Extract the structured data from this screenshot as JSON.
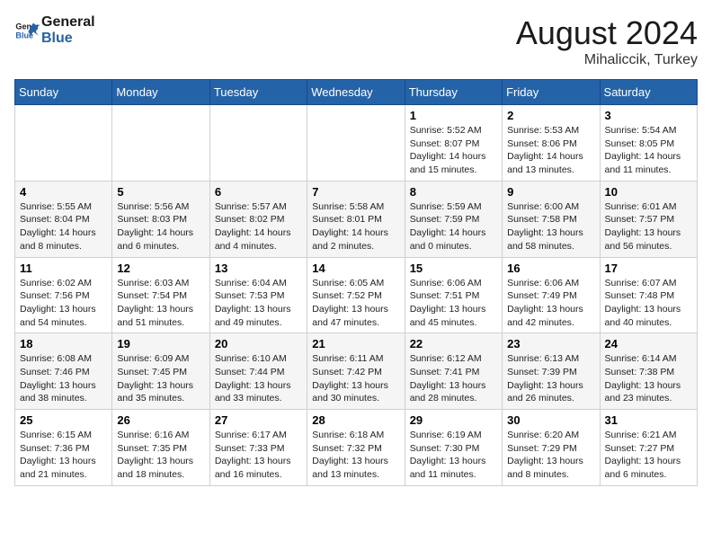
{
  "header": {
    "logo_general": "General",
    "logo_blue": "Blue",
    "month": "August 2024",
    "location": "Mihaliccik, Turkey"
  },
  "days_of_week": [
    "Sunday",
    "Monday",
    "Tuesday",
    "Wednesday",
    "Thursday",
    "Friday",
    "Saturday"
  ],
  "weeks": [
    [
      {
        "day": "",
        "info": ""
      },
      {
        "day": "",
        "info": ""
      },
      {
        "day": "",
        "info": ""
      },
      {
        "day": "",
        "info": ""
      },
      {
        "day": "1",
        "info": "Sunrise: 5:52 AM\nSunset: 8:07 PM\nDaylight: 14 hours\nand 15 minutes."
      },
      {
        "day": "2",
        "info": "Sunrise: 5:53 AM\nSunset: 8:06 PM\nDaylight: 14 hours\nand 13 minutes."
      },
      {
        "day": "3",
        "info": "Sunrise: 5:54 AM\nSunset: 8:05 PM\nDaylight: 14 hours\nand 11 minutes."
      }
    ],
    [
      {
        "day": "4",
        "info": "Sunrise: 5:55 AM\nSunset: 8:04 PM\nDaylight: 14 hours\nand 8 minutes."
      },
      {
        "day": "5",
        "info": "Sunrise: 5:56 AM\nSunset: 8:03 PM\nDaylight: 14 hours\nand 6 minutes."
      },
      {
        "day": "6",
        "info": "Sunrise: 5:57 AM\nSunset: 8:02 PM\nDaylight: 14 hours\nand 4 minutes."
      },
      {
        "day": "7",
        "info": "Sunrise: 5:58 AM\nSunset: 8:01 PM\nDaylight: 14 hours\nand 2 minutes."
      },
      {
        "day": "8",
        "info": "Sunrise: 5:59 AM\nSunset: 7:59 PM\nDaylight: 14 hours\nand 0 minutes."
      },
      {
        "day": "9",
        "info": "Sunrise: 6:00 AM\nSunset: 7:58 PM\nDaylight: 13 hours\nand 58 minutes."
      },
      {
        "day": "10",
        "info": "Sunrise: 6:01 AM\nSunset: 7:57 PM\nDaylight: 13 hours\nand 56 minutes."
      }
    ],
    [
      {
        "day": "11",
        "info": "Sunrise: 6:02 AM\nSunset: 7:56 PM\nDaylight: 13 hours\nand 54 minutes."
      },
      {
        "day": "12",
        "info": "Sunrise: 6:03 AM\nSunset: 7:54 PM\nDaylight: 13 hours\nand 51 minutes."
      },
      {
        "day": "13",
        "info": "Sunrise: 6:04 AM\nSunset: 7:53 PM\nDaylight: 13 hours\nand 49 minutes."
      },
      {
        "day": "14",
        "info": "Sunrise: 6:05 AM\nSunset: 7:52 PM\nDaylight: 13 hours\nand 47 minutes."
      },
      {
        "day": "15",
        "info": "Sunrise: 6:06 AM\nSunset: 7:51 PM\nDaylight: 13 hours\nand 45 minutes."
      },
      {
        "day": "16",
        "info": "Sunrise: 6:06 AM\nSunset: 7:49 PM\nDaylight: 13 hours\nand 42 minutes."
      },
      {
        "day": "17",
        "info": "Sunrise: 6:07 AM\nSunset: 7:48 PM\nDaylight: 13 hours\nand 40 minutes."
      }
    ],
    [
      {
        "day": "18",
        "info": "Sunrise: 6:08 AM\nSunset: 7:46 PM\nDaylight: 13 hours\nand 38 minutes."
      },
      {
        "day": "19",
        "info": "Sunrise: 6:09 AM\nSunset: 7:45 PM\nDaylight: 13 hours\nand 35 minutes."
      },
      {
        "day": "20",
        "info": "Sunrise: 6:10 AM\nSunset: 7:44 PM\nDaylight: 13 hours\nand 33 minutes."
      },
      {
        "day": "21",
        "info": "Sunrise: 6:11 AM\nSunset: 7:42 PM\nDaylight: 13 hours\nand 30 minutes."
      },
      {
        "day": "22",
        "info": "Sunrise: 6:12 AM\nSunset: 7:41 PM\nDaylight: 13 hours\nand 28 minutes."
      },
      {
        "day": "23",
        "info": "Sunrise: 6:13 AM\nSunset: 7:39 PM\nDaylight: 13 hours\nand 26 minutes."
      },
      {
        "day": "24",
        "info": "Sunrise: 6:14 AM\nSunset: 7:38 PM\nDaylight: 13 hours\nand 23 minutes."
      }
    ],
    [
      {
        "day": "25",
        "info": "Sunrise: 6:15 AM\nSunset: 7:36 PM\nDaylight: 13 hours\nand 21 minutes."
      },
      {
        "day": "26",
        "info": "Sunrise: 6:16 AM\nSunset: 7:35 PM\nDaylight: 13 hours\nand 18 minutes."
      },
      {
        "day": "27",
        "info": "Sunrise: 6:17 AM\nSunset: 7:33 PM\nDaylight: 13 hours\nand 16 minutes."
      },
      {
        "day": "28",
        "info": "Sunrise: 6:18 AM\nSunset: 7:32 PM\nDaylight: 13 hours\nand 13 minutes."
      },
      {
        "day": "29",
        "info": "Sunrise: 6:19 AM\nSunset: 7:30 PM\nDaylight: 13 hours\nand 11 minutes."
      },
      {
        "day": "30",
        "info": "Sunrise: 6:20 AM\nSunset: 7:29 PM\nDaylight: 13 hours\nand 8 minutes."
      },
      {
        "day": "31",
        "info": "Sunrise: 6:21 AM\nSunset: 7:27 PM\nDaylight: 13 hours\nand 6 minutes."
      }
    ]
  ]
}
